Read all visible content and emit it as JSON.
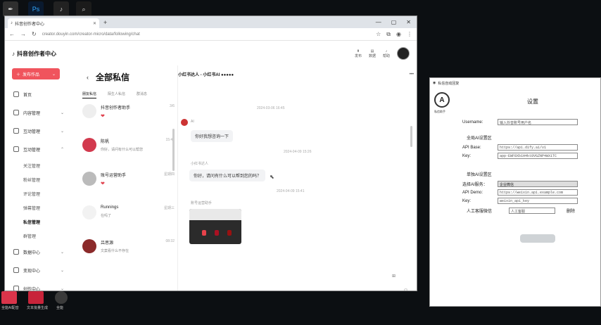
{
  "desktop": {
    "icons": [
      {
        "name": "app-icon-1",
        "glyph": "✒"
      },
      {
        "name": "photoshop-icon",
        "glyph": "Ps"
      },
      {
        "name": "app-icon-3",
        "glyph": "♪"
      },
      {
        "name": "app-icon-4",
        "glyph": "⌕"
      }
    ],
    "bottom_labels": [
      "全能AI配音",
      "文本批量生成",
      "全能"
    ]
  },
  "browser": {
    "tab_title": "抖音创作者中心",
    "url": "creator.douyin.com/creator-micro/data/following/chat",
    "logo_text": "抖音创作者中心",
    "top_buttons": [
      "发布",
      "数据",
      "帮助"
    ],
    "publish_label": "发布作品",
    "nav": [
      {
        "label": "首页",
        "expand": ""
      },
      {
        "label": "内容管理",
        "expand": "⌄"
      },
      {
        "label": "互动管理",
        "expand": "⌄"
      },
      {
        "label": "互动管理",
        "expand": "⌃"
      }
    ],
    "nav_sub": [
      "关注管理",
      "粉丝管理",
      "评论管理",
      "弹幕管理",
      "私信管理",
      "群管理"
    ],
    "nav_bottom": [
      {
        "label": "数据中心",
        "expand": "⌄"
      },
      {
        "label": "变现中心",
        "expand": "⌄"
      },
      {
        "label": "创作中心",
        "expand": "⌄"
      }
    ],
    "messages": {
      "title": "全部私信",
      "subtabs": [
        "朋友私信",
        "陌生人私信",
        "群消息"
      ],
      "conversations": [
        {
          "name": "抖音创作者助手",
          "time": "3/6",
          "sub": "❤"
        },
        {
          "name": "陈帆",
          "time": "15:40",
          "sub": "你好，请问有什么可以帮您"
        },
        {
          "name": "账号运营助手",
          "time": "星期四",
          "sub": "❤"
        },
        {
          "name": "Runnings",
          "time": "星期三",
          "sub": "在吗了"
        },
        {
          "name": "吕思源",
          "time": "08:32",
          "sub": "文案看什么不存在"
        }
      ]
    },
    "chat": {
      "header": "小红书达人 - 小红书AI ●●●●●",
      "timestamps": [
        "2024-03-06 16:45",
        "2024-04-09 15:26",
        "2024-04-09 15:41"
      ],
      "messages": [
        {
          "sender": "AI",
          "text": "你好我想咨询一下"
        },
        {
          "sender": "小红书达人",
          "text": "你好，请问有什么可以帮到您的吗？"
        }
      ],
      "card_sender": "账号运营助手"
    }
  },
  "settings": {
    "window_title": "私信自动回复",
    "logo_caption": "私信助手",
    "heading": "设置",
    "username_label": "Username:",
    "username_placeholder": "输入抖音账号用户名",
    "global_section": "全局AI设置区",
    "api_base_label": "API Base:",
    "api_base_value": "https://api.dify.ai/v1",
    "key_label": "Key:",
    "key_value": "app-EWF8Xb1H4kt8VGZNP4WX1TC",
    "single_section": "单独AI设置区",
    "service_label": "选择AI服务：",
    "service_value": "企业微信",
    "api_demo_label": "API Demo:",
    "api_demo_value": "https://weixin.api.example.com",
    "key2_label": "Key:",
    "key2_value": "weixin_api_key",
    "manual_label": "人工客服微信",
    "manual_value": "人工客服",
    "delete_label": "删除"
  },
  "colors": {
    "accent": "#f0545d",
    "desktop": "#0c0f12"
  }
}
